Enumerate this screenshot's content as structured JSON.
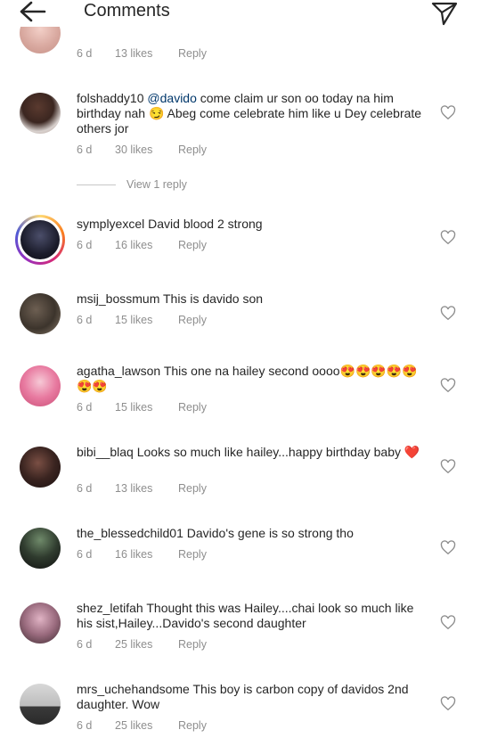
{
  "header": {
    "title": "Comments"
  },
  "top_meta": {
    "time": "6 d",
    "likes": "13 likes",
    "reply": "Reply"
  },
  "comments": [
    {
      "username": "folshaddy10",
      "mention": "@davido",
      "text": " come claim ur son oo today na him birthday nah 😏 Abeg come celebrate him like u Dey celebrate others jor",
      "time": "6 d",
      "likes": "30 likes",
      "reply": "Reply"
    },
    {
      "username": "symplyexcel",
      "text": "David blood 2 strong",
      "time": "6 d",
      "likes": "16 likes",
      "reply": "Reply"
    },
    {
      "username": "msij_bossmum",
      "text": "This is davido son",
      "time": "6 d",
      "likes": "15 likes",
      "reply": "Reply"
    },
    {
      "username": "agatha_lawson",
      "text": "This one na hailey second oooo😍😍😍😍😍😍😍",
      "time": "6 d",
      "likes": "15 likes",
      "reply": "Reply"
    },
    {
      "username": "bibi__blaq",
      "text": "Looks so much like hailey...happy birthday baby ❤️",
      "time": "6 d",
      "likes": "13 likes",
      "reply": "Reply"
    },
    {
      "username": "the_blessedchild01",
      "text": "Davido's gene is so strong tho",
      "time": "6 d",
      "likes": "16 likes",
      "reply": "Reply"
    },
    {
      "username": "shez_letifah",
      "text": "Thought this was Hailey....chai look so much like his sist,Hailey...Davido's second daughter",
      "time": "6 d",
      "likes": "25 likes",
      "reply": "Reply"
    },
    {
      "username": "mrs_uchehandsome",
      "text": "This boy is carbon copy of davidos 2nd daughter. Wow",
      "time": "6 d",
      "likes": "25 likes",
      "reply": "Reply"
    }
  ],
  "view_replies": "View 1 reply",
  "icons": {
    "back": "arrow-left-icon",
    "send": "send-icon",
    "like": "heart-outline-icon"
  },
  "colors": {
    "text": "#262626",
    "meta": "#8e8e8e",
    "mention": "#00376b"
  }
}
